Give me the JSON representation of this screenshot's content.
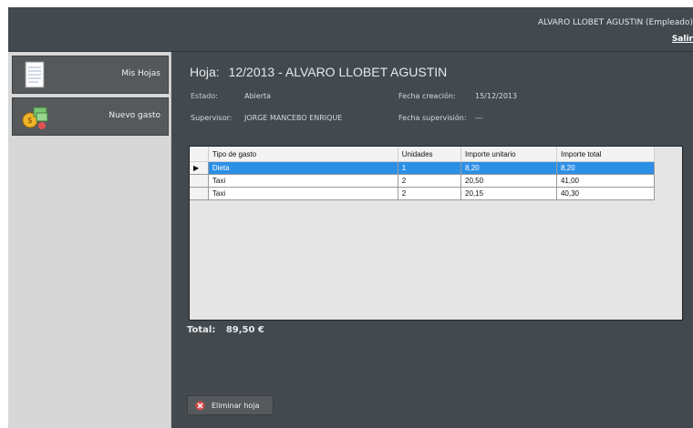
{
  "header": {
    "user": "ALVARO LLOBET AGUSTIN (Empleado)",
    "logout": "Salir"
  },
  "sidebar": {
    "items": [
      {
        "label": "Mis Hojas",
        "icon": "sheet-icon"
      },
      {
        "label": "Nuevo gasto",
        "icon": "money-icon"
      }
    ]
  },
  "sheet": {
    "label": "Hoja:",
    "value": "12/2013 - ALVARO LLOBET AGUSTIN",
    "estado_label": "Estado:",
    "estado": "Abierta",
    "fecha_creacion_label": "Fecha creación:",
    "fecha_creacion": "15/12/2013",
    "supervisor_label": "Supervisor:",
    "supervisor": "JORGE MANCEBO ENRIQUE",
    "fecha_supervision_label": "Fecha supervisión:",
    "fecha_supervision": "---"
  },
  "table": {
    "columns": [
      "Tipo de gasto",
      "Unidades",
      "Importe unitario",
      "Importe total"
    ],
    "rows": [
      [
        "Dieta",
        "1",
        "8,20",
        "8,20"
      ],
      [
        "Taxi",
        "2",
        "20,50",
        "41,00"
      ],
      [
        "Taxi",
        "2",
        "20,15",
        "40,30"
      ]
    ],
    "selected_row_marker": "▶"
  },
  "total": {
    "label": "Total:",
    "value": "89,50 €"
  },
  "actions": {
    "delete_label": "Eliminar hoja"
  },
  "colors": {
    "background": "#424a50",
    "sidebar": "#d7d7d7",
    "selection": "#2c8fe6"
  }
}
